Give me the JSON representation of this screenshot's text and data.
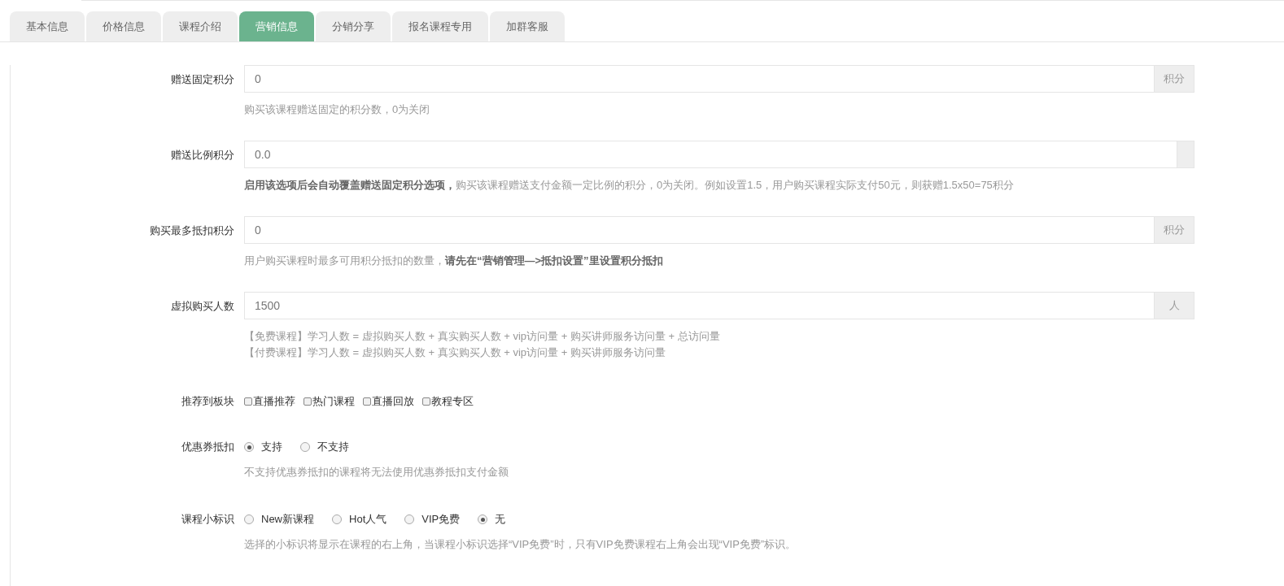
{
  "tabs": [
    {
      "label": "基本信息",
      "selected": false
    },
    {
      "label": "价格信息",
      "selected": false
    },
    {
      "label": "课程介绍",
      "selected": false
    },
    {
      "label": "营销信息",
      "selected": true
    },
    {
      "label": "分销分享",
      "selected": false
    },
    {
      "label": "报名课程专用",
      "selected": false
    },
    {
      "label": "加群客服",
      "selected": false
    }
  ],
  "fields": [
    {
      "kind": "input",
      "label": "赠送固定积分",
      "value": "0",
      "addon": "积分",
      "help": [
        "购买该课程赠送固定的积分数，0为关闭"
      ]
    },
    {
      "kind": "input",
      "label": "赠送比例积分",
      "value": "0.0",
      "addon_empty": true,
      "help": [
        "**启用该选项后会自动覆盖赠送固定积分选项，**购买该课程赠送支付金额一定比例的积分，0为关闭。例如设置1.5，用户购买课程实际支付50元，则获赠1.5x50=75积分"
      ]
    },
    {
      "kind": "input",
      "label": "购买最多抵扣积分",
      "value": "0",
      "addon": "积分",
      "help": [
        "用户购买课程时最多可用积分抵扣的数量，**请先在“营销管理—>抵扣设置”里设置积分抵扣**"
      ]
    },
    {
      "kind": "input",
      "label": "虚拟购买人数",
      "value": "1500",
      "addon": "人",
      "help": [
        "【免费课程】学习人数 = 虚拟购买人数 + 真实购买人数 + vip访问量 + 购买讲师服务访问量 + 总访问量",
        "【付费课程】学习人数 = 虚拟购买人数 + 真实购买人数 + vip访问量 + 购买讲师服务访问量"
      ]
    },
    {
      "kind": "checkbox",
      "label": "推荐到板块",
      "options": [
        {
          "label": "直播推荐",
          "checked": false
        },
        {
          "label": "热门课程",
          "checked": false
        },
        {
          "label": "直播回放",
          "checked": false
        },
        {
          "label": "教程专区",
          "checked": false
        }
      ]
    },
    {
      "kind": "radio",
      "label": "优惠券抵扣",
      "options": [
        {
          "label": "支持",
          "selected": true
        },
        {
          "label": "不支持",
          "selected": false
        }
      ],
      "help": [
        "不支持优惠券抵扣的课程将无法使用优惠券抵扣支付金额"
      ]
    },
    {
      "kind": "radio",
      "label": "课程小标识",
      "options": [
        {
          "label": "New新课程",
          "selected": false
        },
        {
          "label": "Hot人气",
          "selected": false
        },
        {
          "label": "VIP免费",
          "selected": false
        },
        {
          "label": "无",
          "selected": true
        }
      ],
      "help": [
        "选择的小标识将显示在课程的右上角，当课程小标识选择“VIP免费”时，只有VIP免费课程右上角会出现“VIP免费”标识。"
      ]
    }
  ]
}
